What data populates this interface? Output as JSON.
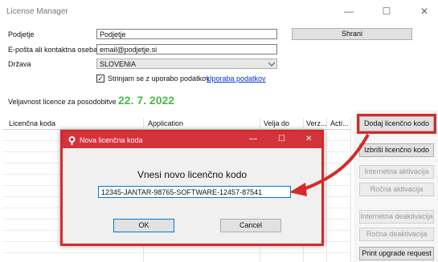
{
  "window": {
    "title": "License Manager",
    "minimize": "—",
    "maximize": "☐",
    "close": "✕"
  },
  "form": {
    "company_label": "Podjetje",
    "company_value": "Podjetje",
    "email_label": "E-pošta ali kontaktna oseba",
    "email_value": "email@podjetje.si",
    "country_label": "Država",
    "country_value": "SLOVENIA",
    "consent_text": "Strinjam se z uporabo podatkov",
    "consent_link": "Uporaba podatkov",
    "consent_checked": "✓",
    "save_button": "Shrani",
    "validity_label": "Veljavnost licence za posodobitve",
    "validity_date": "22. 7. 2022"
  },
  "table": {
    "columns": [
      "Licenčna koda",
      "Application",
      "Velja do",
      "Verz...",
      "Acti..."
    ]
  },
  "actions": {
    "add_code": "Dodaj licenčno kodo",
    "delete_code": "Izbriši licenčno kodo",
    "internet_activation": "Internetna aktivacija",
    "manual_activation": "Ročna aktivacija",
    "internet_deactivation": "Internetna deaktivacija",
    "manual_deactivation": "Ročna deaktivacija",
    "print_upgrade": "Print upgrade request"
  },
  "dialog": {
    "title": "Nova licenčna koda",
    "prompt": "Vnesi novo licenčno kodo",
    "code_value": "12345-JANTAR-98765-SOFTWARE-12457-87541",
    "ok": "OK",
    "cancel": "Cancel",
    "minimize": "—",
    "maximize": "☐",
    "close": "✕"
  },
  "colors": {
    "accent_red": "#d42a2a",
    "dialog_title_bg": "#d4333b",
    "validity_green": "#4db84d",
    "link_blue": "#0033cc"
  }
}
